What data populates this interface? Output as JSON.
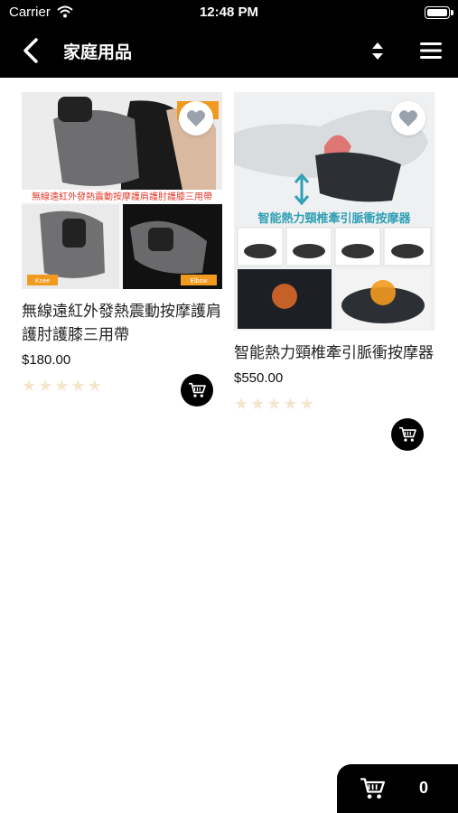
{
  "status_bar": {
    "carrier": "Carrier",
    "time": "12:48 PM"
  },
  "nav": {
    "title": "家庭用品"
  },
  "products": [
    {
      "name": "無線遠紅外發熱震動按摩護肩護肘護膝三用帶",
      "price": "$180.00",
      "rating": 0,
      "image_labels": {
        "banner": "無線遠紅外發熱震動按摩護肩護肘護膝三用帶",
        "left": "Knee",
        "right": "Elbow"
      }
    },
    {
      "name": "智能熱力頸椎牽引脈衝按摩器",
      "price": "$550.00",
      "rating": 0,
      "image_labels": {
        "banner": "智能熱力頸椎牽引脈衝按摩器"
      }
    }
  ],
  "cart": {
    "count": "0"
  },
  "colors": {
    "bar": "#000000",
    "star_empty": "#f4e6cc",
    "banner_red": "#e23a2a",
    "banner_teal": "#2f9fb4",
    "label_orange": "#f29a1f"
  }
}
